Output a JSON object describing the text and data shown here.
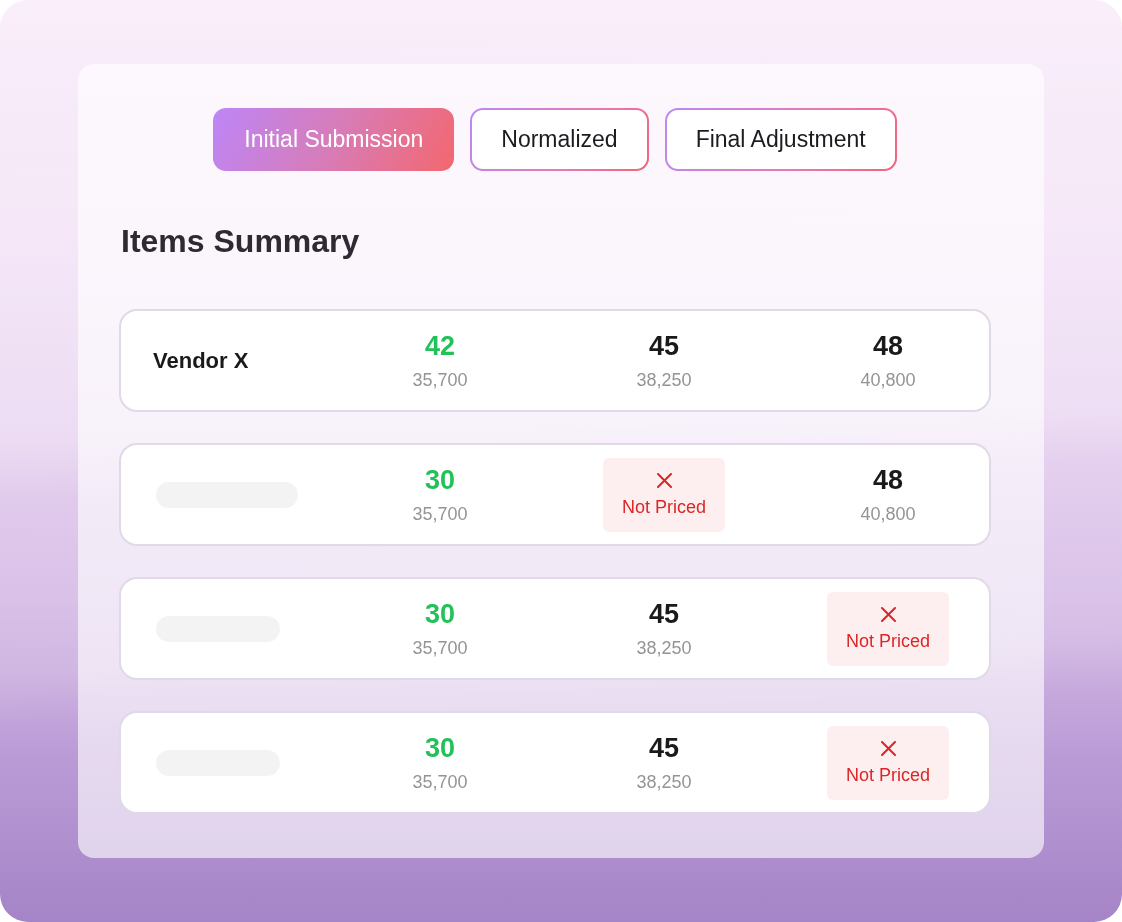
{
  "tabs": [
    {
      "label": "Initial Submission",
      "selected": true
    },
    {
      "label": "Normalized",
      "selected": false
    },
    {
      "label": "Final Adjustment",
      "selected": false
    }
  ],
  "section": {
    "title": "Items Summary"
  },
  "rows": [
    {
      "vendor": {
        "kind": "text",
        "text": "Vendor X"
      },
      "cells": [
        {
          "kind": "price",
          "value": "42",
          "total": "35,700",
          "best": true
        },
        {
          "kind": "price",
          "value": "45",
          "total": "38,250",
          "best": false
        },
        {
          "kind": "price",
          "value": "48",
          "total": "40,800",
          "best": false
        }
      ]
    },
    {
      "vendor": {
        "kind": "skeleton",
        "wide": true
      },
      "cells": [
        {
          "kind": "price",
          "value": "30",
          "total": "35,700",
          "best": true
        },
        {
          "kind": "not_priced",
          "label": "Not Priced"
        },
        {
          "kind": "price",
          "value": "48",
          "total": "40,800",
          "best": false
        }
      ]
    },
    {
      "vendor": {
        "kind": "skeleton",
        "wide": false
      },
      "cells": [
        {
          "kind": "price",
          "value": "30",
          "total": "35,700",
          "best": true
        },
        {
          "kind": "price",
          "value": "45",
          "total": "38,250",
          "best": false
        },
        {
          "kind": "not_priced",
          "label": "Not Priced"
        }
      ]
    },
    {
      "vendor": {
        "kind": "skeleton",
        "wide": false
      },
      "cells": [
        {
          "kind": "price",
          "value": "30",
          "total": "35,700",
          "best": true
        },
        {
          "kind": "price",
          "value": "45",
          "total": "38,250",
          "best": false
        },
        {
          "kind": "not_priced",
          "label": "Not Priced"
        }
      ]
    }
  ]
}
